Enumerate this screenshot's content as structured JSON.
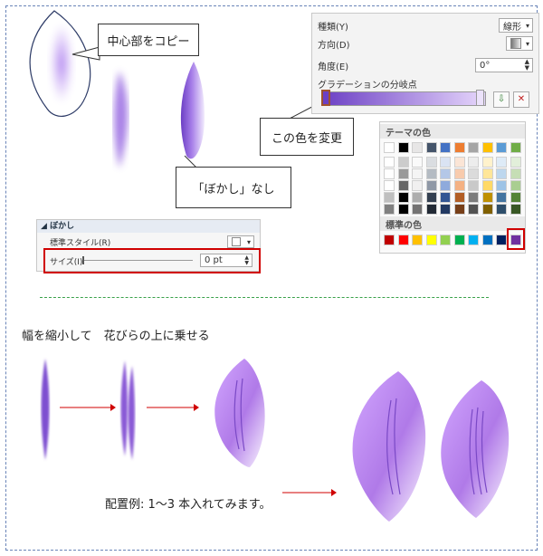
{
  "callouts": {
    "copy_center": "中心部をコピー",
    "change_color": "この色を変更",
    "no_blur": "「ぼかし」なし"
  },
  "gradient_panel": {
    "type_label": "種類(Y)",
    "type_value": "線形",
    "direction_label": "方向(D)",
    "angle_label": "角度(E)",
    "angle_value": "0°",
    "stops_label": "グラデーションの分岐点"
  },
  "color_palette": {
    "theme_header": "テーマの色",
    "standard_header": "標準の色",
    "theme_colors": [
      "#ffffff",
      "#000000",
      "#e7e6e6",
      "#44546a",
      "#4472c4",
      "#ed7d31",
      "#a5a5a5",
      "#ffc000",
      "#5b9bd5",
      "#70ad47"
    ],
    "standard_colors": [
      "#c00000",
      "#ff0000",
      "#ffc000",
      "#ffff00",
      "#92d050",
      "#00b050",
      "#00b0f0",
      "#0070c0",
      "#002060",
      "#7030a0"
    ]
  },
  "blur_panel": {
    "header": "ぼかし",
    "preset_label": "標準スタイル(R)",
    "size_label": "サイズ(I)",
    "size_value": "0 pt"
  },
  "bottom": {
    "heading": "幅を縮小して　花びらの上に乗せる",
    "example_caption": "配置例: 1～3 本入れてみます。"
  }
}
